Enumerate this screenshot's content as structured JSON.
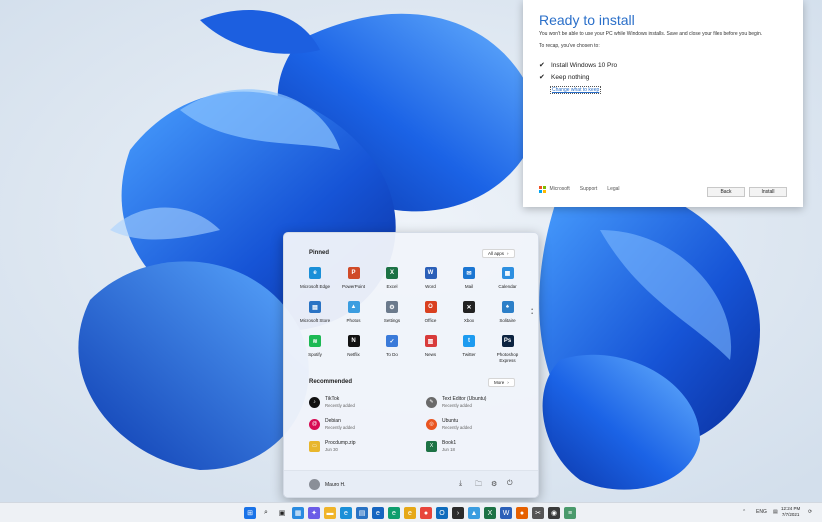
{
  "colors": {
    "accent": "#2a6fc9",
    "wallpaper_bg": "#dde7f2",
    "bloom_dark": "#0a3fb8",
    "bloom_light": "#3d8df5"
  },
  "installer": {
    "title": "Ready to install",
    "warning": "You won't be able to use your PC while Windows installs. Save and close your files before you begin.",
    "recap": "To recap, you've chosen to:",
    "choices": [
      "Install Windows 10 Pro",
      "Keep nothing"
    ],
    "change_link": "Change what to keep",
    "footer_brand": "Microsoft",
    "footer_support": "Support",
    "footer_legal": "Legal",
    "back_button": "Back",
    "install_button": "Install"
  },
  "start_menu": {
    "pinned_title": "Pinned",
    "all_apps": "All apps",
    "pinned": [
      {
        "label": "Microsoft Edge",
        "icon": "edge-icon",
        "color": "#1a8fd8"
      },
      {
        "label": "PowerPoint",
        "icon": "powerpoint-icon",
        "color": "#d04a28"
      },
      {
        "label": "Excel",
        "icon": "excel-icon",
        "color": "#1d7245"
      },
      {
        "label": "Word",
        "icon": "word-icon",
        "color": "#2b5fb8"
      },
      {
        "label": "Mail",
        "icon": "mail-icon",
        "color": "#1b76d2"
      },
      {
        "label": "Calendar",
        "icon": "calendar-icon",
        "color": "#2d8fe0"
      },
      {
        "label": "Microsoft Store",
        "icon": "store-icon",
        "color": "#2a73c4"
      },
      {
        "label": "Photos",
        "icon": "photos-icon",
        "color": "#3b9de0"
      },
      {
        "label": "Settings",
        "icon": "settings-icon",
        "color": "#6b7a8c"
      },
      {
        "label": "Office",
        "icon": "office-icon",
        "color": "#d9401f"
      },
      {
        "label": "Xbox",
        "icon": "xbox-icon",
        "color": "#222222"
      },
      {
        "label": "Solitaire",
        "icon": "solitaire-icon",
        "color": "#2c7fc8"
      },
      {
        "label": "Spotify",
        "icon": "spotify-icon",
        "color": "#1db954"
      },
      {
        "label": "Netflix",
        "icon": "netflix-icon",
        "color": "#111111"
      },
      {
        "label": "To Do",
        "icon": "todo-icon",
        "color": "#3a7ad9"
      },
      {
        "label": "News",
        "icon": "news-icon",
        "color": "#d83b3b"
      },
      {
        "label": "Twitter",
        "icon": "twitter-icon",
        "color": "#1d9bf0"
      },
      {
        "label": "Photoshop Express",
        "icon": "photoshop-icon",
        "color": "#0c2340"
      }
    ],
    "recommended_title": "Recommended",
    "more": "More",
    "recommended": [
      {
        "name": "TikTok",
        "sub": "Recently added",
        "icon": "tiktok-icon",
        "color": "#111111"
      },
      {
        "name": "Text Editor (Ubuntu)",
        "sub": "Recently added",
        "icon": "text-editor-icon",
        "color": "#6a6a6a"
      },
      {
        "name": "Debian",
        "sub": "Recently added",
        "icon": "debian-icon",
        "color": "#d70a53"
      },
      {
        "name": "Ubuntu",
        "sub": "Recently added",
        "icon": "ubuntu-icon",
        "color": "#e95420"
      },
      {
        "name": "Procdump.zip",
        "sub": "Jun 30",
        "icon": "zip-folder-icon",
        "color": "#e8b62c"
      },
      {
        "name": "Book1",
        "sub": "Jun 18",
        "icon": "excel-file-icon",
        "color": "#1d7245"
      }
    ],
    "user_name": "Mauro H."
  },
  "taskbar": {
    "lang": "ENG",
    "time": "12:24 PM",
    "date": "7/7/2021"
  }
}
